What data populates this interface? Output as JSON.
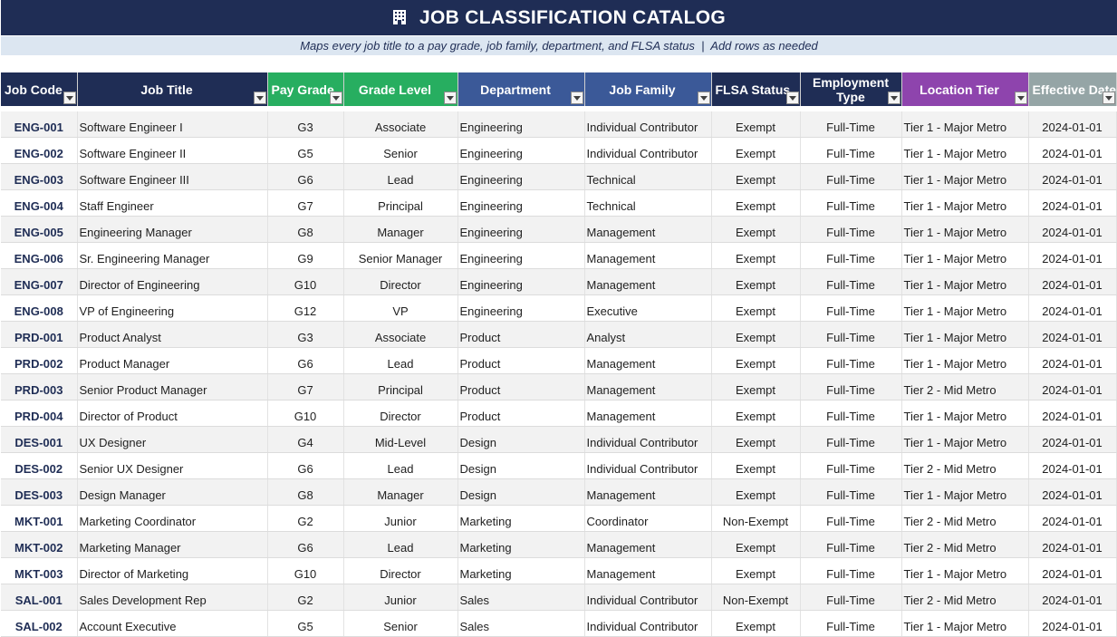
{
  "title": "JOB CLASSIFICATION CATALOG",
  "title_icon": "building-icon",
  "subtitle": "Maps every job title to a pay grade, job family, department, and FLSA status  |  Add rows as needed",
  "colors": {
    "navy": "#1f2d55",
    "green": "#27ae60",
    "blue": "#3b5998",
    "purple": "#8e44ad",
    "gray": "#95a5a6",
    "subtitle_bg": "#dce6f1"
  },
  "columns": [
    "Job Code",
    "Job Title",
    "Pay Grade",
    "Grade Level",
    "Department",
    "Job Family",
    "FLSA Status",
    "Employment Type",
    "Location Tier",
    "Effective Date"
  ],
  "rows": [
    [
      "ENG-001",
      "Software Engineer I",
      "G3",
      "Associate",
      "Engineering",
      "Individual Contributor",
      "Exempt",
      "Full-Time",
      "Tier 1 - Major Metro",
      "2024-01-01"
    ],
    [
      "ENG-002",
      "Software Engineer II",
      "G5",
      "Senior",
      "Engineering",
      "Individual Contributor",
      "Exempt",
      "Full-Time",
      "Tier 1 - Major Metro",
      "2024-01-01"
    ],
    [
      "ENG-003",
      "Software Engineer III",
      "G6",
      "Lead",
      "Engineering",
      "Technical",
      "Exempt",
      "Full-Time",
      "Tier 1 - Major Metro",
      "2024-01-01"
    ],
    [
      "ENG-004",
      "Staff Engineer",
      "G7",
      "Principal",
      "Engineering",
      "Technical",
      "Exempt",
      "Full-Time",
      "Tier 1 - Major Metro",
      "2024-01-01"
    ],
    [
      "ENG-005",
      "Engineering Manager",
      "G8",
      "Manager",
      "Engineering",
      "Management",
      "Exempt",
      "Full-Time",
      "Tier 1 - Major Metro",
      "2024-01-01"
    ],
    [
      "ENG-006",
      "Sr. Engineering Manager",
      "G9",
      "Senior Manager",
      "Engineering",
      "Management",
      "Exempt",
      "Full-Time",
      "Tier 1 - Major Metro",
      "2024-01-01"
    ],
    [
      "ENG-007",
      "Director of Engineering",
      "G10",
      "Director",
      "Engineering",
      "Management",
      "Exempt",
      "Full-Time",
      "Tier 1 - Major Metro",
      "2024-01-01"
    ],
    [
      "ENG-008",
      "VP of Engineering",
      "G12",
      "VP",
      "Engineering",
      "Executive",
      "Exempt",
      "Full-Time",
      "Tier 1 - Major Metro",
      "2024-01-01"
    ],
    [
      "PRD-001",
      "Product Analyst",
      "G3",
      "Associate",
      "Product",
      "Analyst",
      "Exempt",
      "Full-Time",
      "Tier 1 - Major Metro",
      "2024-01-01"
    ],
    [
      "PRD-002",
      "Product Manager",
      "G6",
      "Lead",
      "Product",
      "Management",
      "Exempt",
      "Full-Time",
      "Tier 1 - Major Metro",
      "2024-01-01"
    ],
    [
      "PRD-003",
      "Senior Product Manager",
      "G7",
      "Principal",
      "Product",
      "Management",
      "Exempt",
      "Full-Time",
      "Tier 2 - Mid Metro",
      "2024-01-01"
    ],
    [
      "PRD-004",
      "Director of Product",
      "G10",
      "Director",
      "Product",
      "Management",
      "Exempt",
      "Full-Time",
      "Tier 1 - Major Metro",
      "2024-01-01"
    ],
    [
      "DES-001",
      "UX Designer",
      "G4",
      "Mid-Level",
      "Design",
      "Individual Contributor",
      "Exempt",
      "Full-Time",
      "Tier 1 - Major Metro",
      "2024-01-01"
    ],
    [
      "DES-002",
      "Senior UX Designer",
      "G6",
      "Lead",
      "Design",
      "Individual Contributor",
      "Exempt",
      "Full-Time",
      "Tier 2 - Mid Metro",
      "2024-01-01"
    ],
    [
      "DES-003",
      "Design Manager",
      "G8",
      "Manager",
      "Design",
      "Management",
      "Exempt",
      "Full-Time",
      "Tier 1 - Major Metro",
      "2024-01-01"
    ],
    [
      "MKT-001",
      "Marketing Coordinator",
      "G2",
      "Junior",
      "Marketing",
      "Coordinator",
      "Non-Exempt",
      "Full-Time",
      "Tier 2 - Mid Metro",
      "2024-01-01"
    ],
    [
      "MKT-002",
      "Marketing Manager",
      "G6",
      "Lead",
      "Marketing",
      "Management",
      "Exempt",
      "Full-Time",
      "Tier 2 - Mid Metro",
      "2024-01-01"
    ],
    [
      "MKT-003",
      "Director of Marketing",
      "G10",
      "Director",
      "Marketing",
      "Management",
      "Exempt",
      "Full-Time",
      "Tier 1 - Major Metro",
      "2024-01-01"
    ],
    [
      "SAL-001",
      "Sales Development Rep",
      "G2",
      "Junior",
      "Sales",
      "Individual Contributor",
      "Non-Exempt",
      "Full-Time",
      "Tier 2 - Mid Metro",
      "2024-01-01"
    ],
    [
      "SAL-002",
      "Account Executive",
      "G5",
      "Senior",
      "Sales",
      "Individual Contributor",
      "Exempt",
      "Full-Time",
      "Tier 1 - Major Metro",
      "2024-01-01"
    ]
  ]
}
